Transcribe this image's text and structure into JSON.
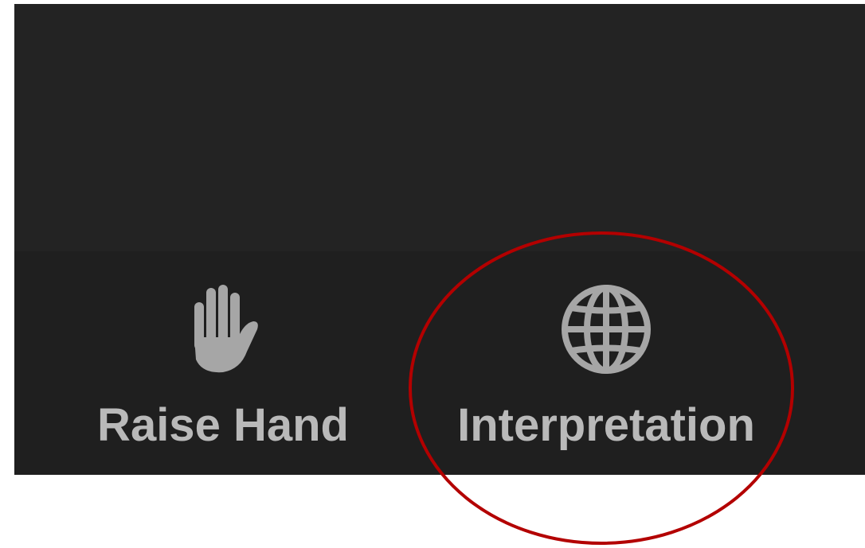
{
  "toolbar": {
    "raise_hand": {
      "label": "Raise Hand",
      "icon": "hand-icon"
    },
    "interpretation": {
      "label": "Interpretation",
      "icon": "globe-icon"
    }
  },
  "colors": {
    "meeting_background": "#232323",
    "toolbar_background": "#1f1f1f",
    "label_color": "#b9b9b9",
    "icon_color": "#a6a6a6",
    "annotation_circle": "#b30000"
  }
}
